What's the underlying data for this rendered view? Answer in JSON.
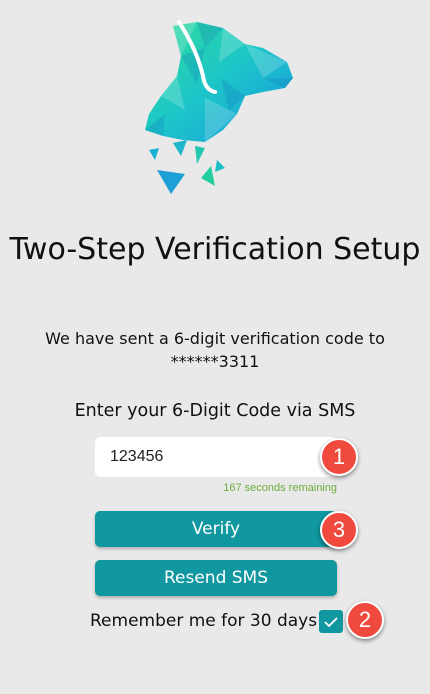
{
  "page": {
    "title": "Two-Step Verification Setup",
    "subtitle_line1": "We have sent a 6-digit verification code to",
    "subtitle_line2": "******3311",
    "code_label": "Enter your 6-Digit Code via SMS"
  },
  "code_input": {
    "value": "123456"
  },
  "timer": {
    "text": "167 seconds remaining"
  },
  "buttons": {
    "verify": "Verify",
    "resend": "Resend SMS"
  },
  "remember": {
    "label": "Remember me for 30 days",
    "checked": true
  },
  "badges": {
    "one": "1",
    "two": "2",
    "three": "3"
  },
  "colors": {
    "accent": "#11979f",
    "badge": "#f04a3f",
    "timer": "#6cae3e",
    "background": "#e9e9e9"
  },
  "logo": {
    "icon": "dog-head-icon"
  }
}
